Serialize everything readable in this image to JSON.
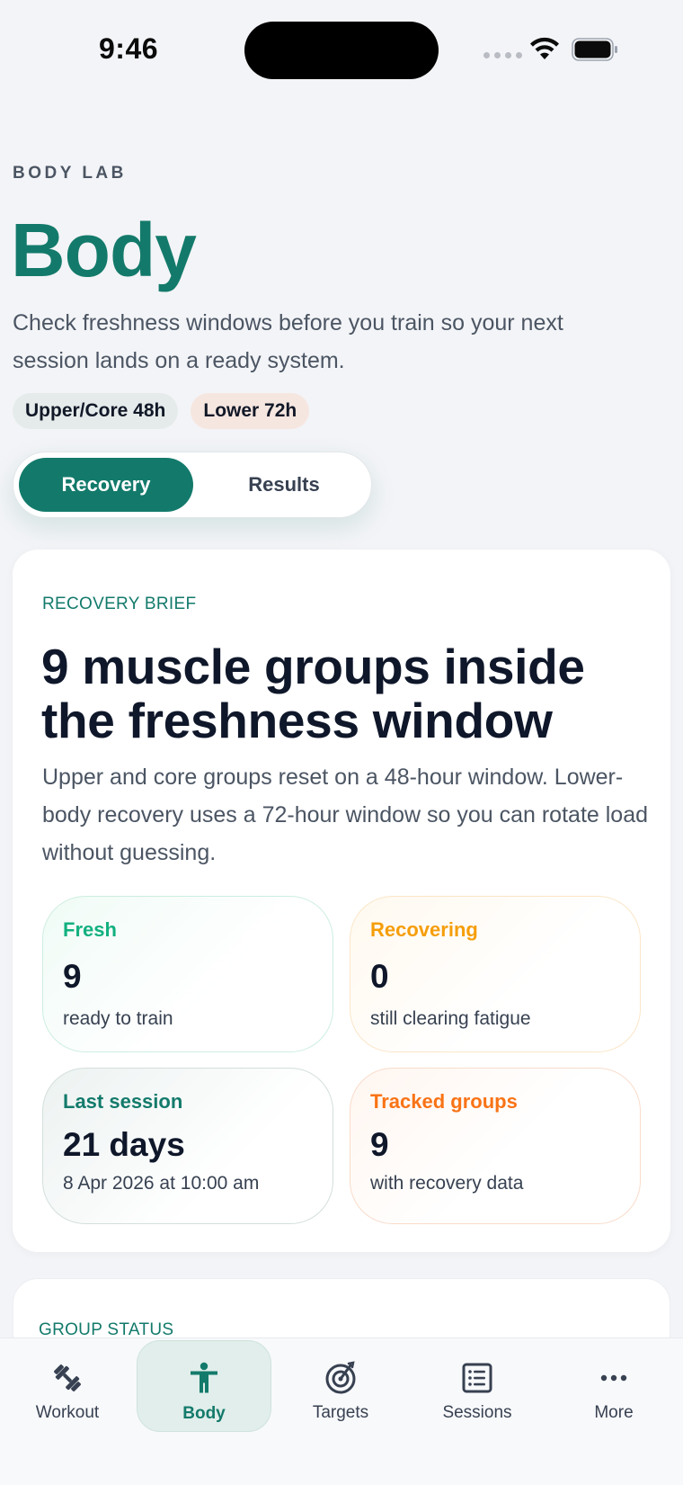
{
  "status_bar": {
    "time": "9:46"
  },
  "header": {
    "eyebrow": "BODY LAB",
    "title": "Body",
    "subtitle": "Check freshness windows before you train so your next session lands on a ready system.",
    "chips": [
      {
        "label": "Upper/Core 48h"
      },
      {
        "label": "Lower 72h"
      }
    ]
  },
  "segmented": {
    "options": [
      "Recovery",
      "Results"
    ],
    "selected": "Recovery"
  },
  "recovery_card": {
    "eyebrow": "RECOVERY BRIEF",
    "title": "9 muscle groups inside the freshness window",
    "description": "Upper and core groups reset on a 48-hour window. Lower-body recovery uses a 72-hour window so you can rotate load without guessing.",
    "stats": {
      "fresh": {
        "label": "Fresh",
        "value": "9",
        "note": "ready to train"
      },
      "recovering": {
        "label": "Recovering",
        "value": "0",
        "note": "still clearing fatigue"
      },
      "last_session": {
        "label": "Last session",
        "value": "21 days",
        "note": "8 Apr 2026 at 10:00 am"
      },
      "tracked": {
        "label": "Tracked groups",
        "value": "9",
        "note": "with recovery data"
      }
    }
  },
  "group_status_card": {
    "eyebrow": "GROUP STATUS"
  },
  "tab_bar": {
    "tabs": [
      {
        "label": "Workout",
        "icon": "dumbbell-icon"
      },
      {
        "label": "Body",
        "icon": "person-icon",
        "active": true
      },
      {
        "label": "Targets",
        "icon": "target-icon"
      },
      {
        "label": "Sessions",
        "icon": "list-icon"
      },
      {
        "label": "More",
        "icon": "ellipsis-icon"
      }
    ]
  },
  "colors": {
    "accent": "#137a6b",
    "fresh": "#12b07f",
    "recovering": "#f59e0b",
    "tracked": "#f97316",
    "background": "#f3f4f7"
  }
}
